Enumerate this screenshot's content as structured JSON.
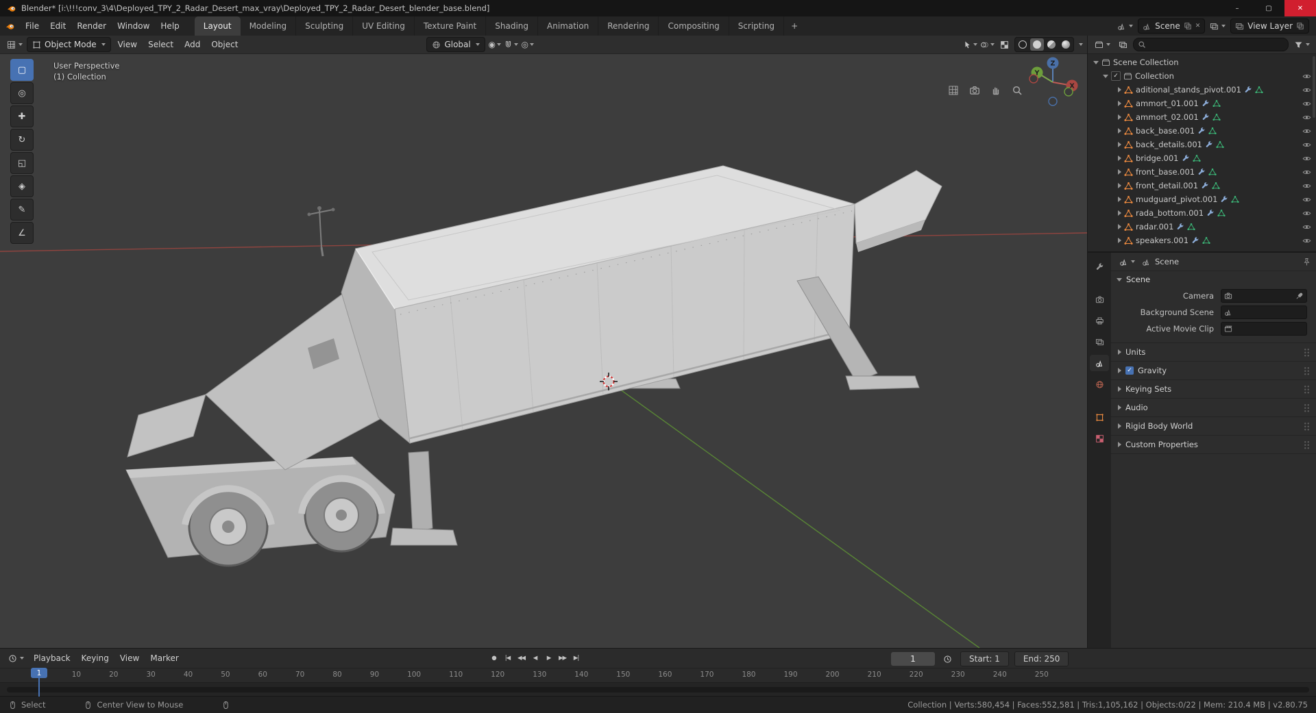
{
  "colors": {
    "accent": "#4772b3",
    "object_orange": "#e8883f",
    "mesh_green": "#3cb878",
    "modifier_blue": "#8cacd8",
    "axis_x": "#aa4742",
    "axis_y": "#6d9e3c",
    "axis_z": "#4a70a8",
    "close_red": "#d11f2f",
    "blender_orange": "#e87d0d"
  },
  "titlebar": {
    "title": "Blender* [i:\\!!!conv_3\\4\\Deployed_TPY_2_Radar_Desert_max_vray\\Deployed_TPY_2_Radar_Desert_blender_base.blend]",
    "buttons": {
      "minimize": "–",
      "maximize": "▢",
      "close": "✕"
    }
  },
  "topbar": {
    "menus": [
      "File",
      "Edit",
      "Render",
      "Window",
      "Help"
    ],
    "workspaces": [
      {
        "label": "Layout",
        "active": true
      },
      {
        "label": "Modeling"
      },
      {
        "label": "Sculpting"
      },
      {
        "label": "UV Editing"
      },
      {
        "label": "Texture Paint"
      },
      {
        "label": "Shading"
      },
      {
        "label": "Animation"
      },
      {
        "label": "Rendering"
      },
      {
        "label": "Compositing"
      },
      {
        "label": "Scripting"
      }
    ],
    "add_workspace": "+",
    "scene": {
      "label": "Scene",
      "delete_glyph": "✕"
    },
    "view_layer": {
      "label": "View Layer"
    }
  },
  "viewport": {
    "header": {
      "mode": "Object Mode",
      "menus": [
        "View",
        "Select",
        "Add",
        "Object"
      ],
      "orientation": "Global",
      "pivot_glyph": "◉",
      "proportional_glyph": "◎"
    },
    "overlay": {
      "line1": "User Perspective",
      "line2": "(1) Collection"
    },
    "gizmo": {
      "x": "X",
      "y": "Y",
      "z": "Z"
    }
  },
  "toolbar": {
    "tools": [
      {
        "glyph": "▢",
        "name": "select-box",
        "active": true
      },
      {
        "glyph": "◎",
        "name": "cursor"
      },
      {
        "glyph": "✚",
        "name": "move"
      },
      {
        "glyph": "↻",
        "name": "rotate"
      },
      {
        "glyph": "◱",
        "name": "scale"
      },
      {
        "glyph": "◈",
        "name": "transform"
      },
      {
        "glyph": "✎",
        "name": "annotate"
      },
      {
        "glyph": "∠",
        "name": "measure"
      }
    ]
  },
  "outliner": {
    "scene_collection": "Scene Collection",
    "collection": "Collection",
    "collection_check": "✓",
    "items": [
      "aditional_stands_pivot.001",
      "ammort_01.001",
      "ammort_02.001",
      "back_base.001",
      "back_details.001",
      "bridge.001",
      "front_base.001",
      "front_detail.001",
      "mudguard_pivot.001",
      "rada_bottom.001",
      "radar.001",
      "speakers.001"
    ]
  },
  "properties": {
    "breadcrumb": "Scene",
    "panel_title": "Scene",
    "camera_label": "Camera",
    "background_scene_label": "Background Scene",
    "active_movie_clip_label": "Active Movie Clip",
    "sections": [
      {
        "label": "Units"
      },
      {
        "label": "Gravity",
        "checkbox": true,
        "check": "✓"
      },
      {
        "label": "Keying Sets"
      },
      {
        "label": "Audio"
      },
      {
        "label": "Rigid Body World"
      },
      {
        "label": "Custom Properties"
      }
    ]
  },
  "timeline": {
    "menus": [
      "Playback",
      "Keying",
      "View",
      "Marker"
    ],
    "transport": [
      {
        "glyph": "●",
        "name": "record"
      },
      {
        "glyph": "|◀",
        "name": "jump-to-start"
      },
      {
        "glyph": "◀◀",
        "name": "previous-keyframe"
      },
      {
        "glyph": "◀",
        "name": "play-reverse"
      },
      {
        "glyph": "▶",
        "name": "play"
      },
      {
        "glyph": "▶▶",
        "name": "next-keyframe"
      },
      {
        "glyph": "▶|",
        "name": "jump-to-end"
      }
    ],
    "current_frame": "1",
    "playhead": "1",
    "start": "Start: 1",
    "end": "End: 250",
    "ticks": [
      "1",
      "10",
      "20",
      "30",
      "40",
      "50",
      "60",
      "70",
      "80",
      "90",
      "100",
      "110",
      "120",
      "130",
      "140",
      "150",
      "160",
      "170",
      "180",
      "190",
      "200",
      "210",
      "220",
      "230",
      "240",
      "250"
    ]
  },
  "statusbar": {
    "left": "Select",
    "middle": "Center View to Mouse",
    "stats": "Collection | Verts:580,454 | Faces:552,581 | Tris:1,105,162 | Objects:0/22 | Mem: 210.4 MB | v2.80.75"
  }
}
